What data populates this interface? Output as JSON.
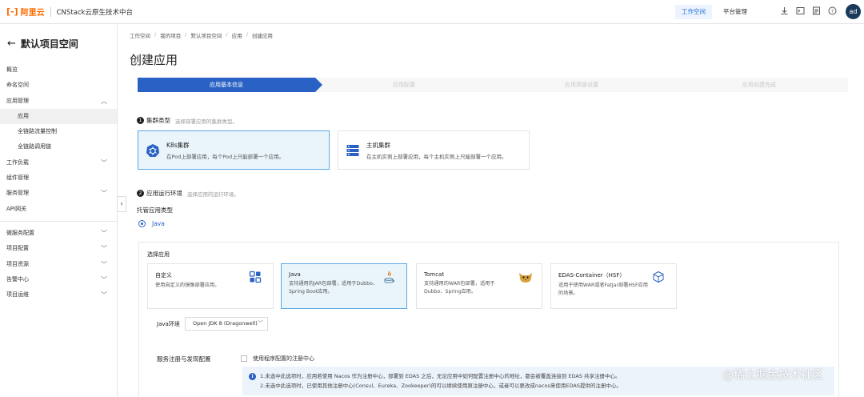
{
  "header": {
    "logo_mark": "[-]",
    "logo_text": "阿里云",
    "app_name": "CNStack云原生技术中台",
    "tabs": [
      {
        "label": "工作空间"
      },
      {
        "label": "平台管理"
      }
    ],
    "avatar_text": "ad",
    "icons": [
      "download-icon",
      "terminal-icon",
      "document-icon",
      "help-icon"
    ]
  },
  "sidebar": {
    "space_title": "默认项目空间",
    "items": [
      {
        "label": "概览"
      },
      {
        "label": "命名空间"
      },
      {
        "label": "应用管理"
      },
      {
        "label": "应用"
      },
      {
        "label": "全链路流量控制"
      },
      {
        "label": "全链路调用链"
      },
      {
        "label": "工作负载"
      },
      {
        "label": "组件管理"
      },
      {
        "label": "服务管理"
      },
      {
        "label": "API网关"
      },
      {
        "label": "微服务配置"
      },
      {
        "label": "项目配置"
      },
      {
        "label": "项目资源"
      },
      {
        "label": "告警中心"
      },
      {
        "label": "项目运维"
      }
    ]
  },
  "breadcrumb": [
    "工作空间",
    "我的项目",
    "默认项目空间",
    "应用",
    "创建应用"
  ],
  "page_title": "创建应用",
  "steps": [
    "应用基本信息",
    "应用配置",
    "应用高级设置",
    "应用创建完成"
  ],
  "cluster_section": {
    "number": "1",
    "title": "集群类型",
    "hint": "选择部署应用的集群类型。",
    "cards": [
      {
        "title": "K8s集群",
        "desc": "在Pod上部署应用，每个Pod上只能部署一个应用。"
      },
      {
        "title": "主机集群",
        "desc": "在主机实例上部署应用，每个主机实例上只能部署一个应用。"
      }
    ]
  },
  "env_section": {
    "number": "2",
    "title": "应用运行环境",
    "hint": "选择应用的运行环境。",
    "host_type_label": "托管应用类型",
    "radio_label": "Java",
    "choose_label": "选择应用",
    "apps": [
      {
        "title": "自定义",
        "desc": "使用自定义的镜像部署应用。"
      },
      {
        "title": "Java",
        "desc": "支持通用的JAR包部署，适用于Dubbo、Spring Boot应用。"
      },
      {
        "title": "Tomcat",
        "desc": "支持通用的WAR包部署，适用于Dubbo、Spring应用。"
      },
      {
        "title": "EDAS-Container（HSF）",
        "desc": "适用于使用WAR或者FatJar部署HSF应用的场景。"
      }
    ],
    "java_env_label": "Java环境",
    "java_env_value": "Open JDK 8 (Dragonwell)",
    "service_label": "服务注册与发现配置",
    "checkbox_label": "使用程序配置的注册中心",
    "info_lines": [
      "1.未选中此选项时，应用若使用 Nacos 作为注册中心，部署到 EDAS 之后，无论应用中如何配置注册中心的地址，都会被覆盖连接到 EDAS 共享注册中心。",
      "2.未选中此选项时，已使用其他注册中心(Consul、Eureka、Zookeeper)的可以继续使用原注册中心，或者可以更改成nacos来使用EDAS提供的注册中心。"
    ]
  },
  "watermark": "@稀土掘金技术社区",
  "colors": {
    "accent": "#2962c4",
    "brand": "#ff6a00",
    "selected_bg": "#eaf5fb",
    "selected_border": "#5aa6e8"
  }
}
